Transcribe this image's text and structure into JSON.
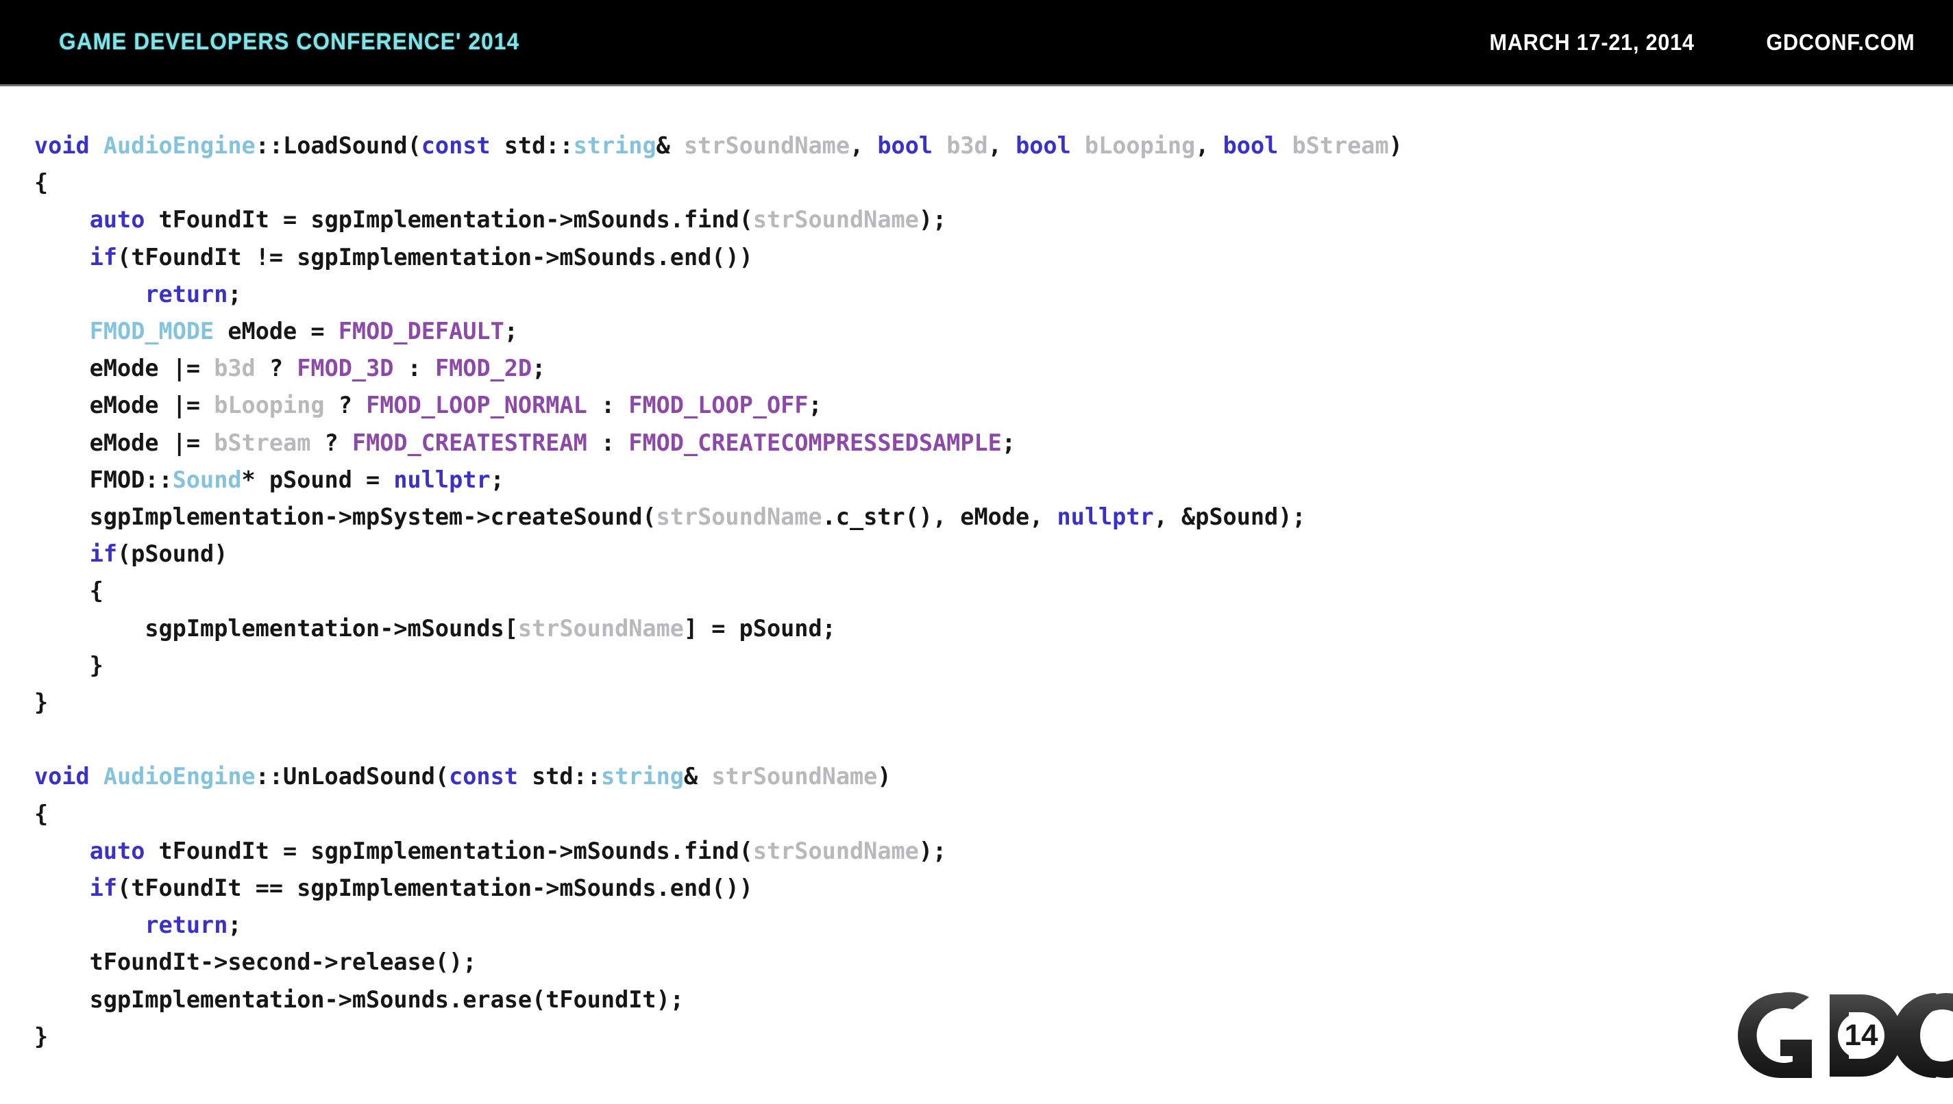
{
  "header": {
    "conference_title": "GAME DEVELOPERS CONFERENCE' 2014",
    "dates": "MARCH 17-21, 2014",
    "url": "GDCONF.COM",
    "bar_background": "#000000",
    "title_color": "#7fe3e8",
    "text_color": "#ffffff"
  },
  "logo": {
    "letters": "GDC",
    "year_badge": "14"
  },
  "syntax_colors": {
    "keyword": "#3a31c8",
    "type": "#83c3dd",
    "parameter": "#b9b9bc",
    "macro": "#8d49a8",
    "plain": "#161616",
    "background": "#ffffff"
  },
  "code": {
    "language": "cpp",
    "lines": [
      "void AudioEngine::LoadSound(const std::string& strSoundName, bool b3d, bool bLooping, bool bStream)",
      "{",
      "    auto tFoundIt = sgpImplementation->mSounds.find(strSoundName);",
      "    if(tFoundIt != sgpImplementation->mSounds.end())",
      "        return;",
      "    FMOD_MODE eMode = FMOD_DEFAULT;",
      "    eMode |= b3d ? FMOD_3D : FMOD_2D;",
      "    eMode |= bLooping ? FMOD_LOOP_NORMAL : FMOD_LOOP_OFF;",
      "    eMode |= bStream ? FMOD_CREATESTREAM : FMOD_CREATECOMPRESSEDSAMPLE;",
      "    FMOD::Sound* pSound = nullptr;",
      "    sgpImplementation->mpSystem->createSound(strSoundName.c_str(), eMode, nullptr, &pSound);",
      "    if(pSound)",
      "    {",
      "        sgpImplementation->mSounds[strSoundName] = pSound;",
      "    }",
      "}",
      "",
      "void AudioEngine::UnLoadSound(const std::string& strSoundName)",
      "{",
      "    auto tFoundIt = sgpImplementation->mSounds.find(strSoundName);",
      "    if(tFoundIt == sgpImplementation->mSounds.end())",
      "        return;",
      "    tFoundIt->second->release();",
      "    sgpImplementation->mSounds.erase(tFoundIt);",
      "}"
    ],
    "tokens": [
      [
        [
          "void ",
          "k-kw"
        ],
        [
          "AudioEngine",
          "k-type"
        ],
        [
          "::",
          "k-pln"
        ],
        [
          "LoadSound",
          "k-pln"
        ],
        [
          "(",
          "k-pln"
        ],
        [
          "const ",
          "k-kw"
        ],
        [
          "std",
          "k-pln"
        ],
        [
          "::",
          "k-pln"
        ],
        [
          "string",
          "k-type"
        ],
        [
          "&",
          "k-pln"
        ],
        [
          " ",
          "k-pln"
        ],
        [
          "strSoundName",
          "k-par"
        ],
        [
          ", ",
          "k-pln"
        ],
        [
          "bool ",
          "k-kw"
        ],
        [
          "b3d",
          "k-par"
        ],
        [
          ", ",
          "k-pln"
        ],
        [
          "bool ",
          "k-kw"
        ],
        [
          "bLooping",
          "k-par"
        ],
        [
          ", ",
          "k-pln"
        ],
        [
          "bool ",
          "k-kw"
        ],
        [
          "bStream",
          "k-par"
        ],
        [
          ")",
          "k-pln"
        ]
      ],
      [
        [
          "{",
          "k-pln"
        ]
      ],
      [
        [
          "    ",
          "k-pln"
        ],
        [
          "auto",
          "k-ctl"
        ],
        [
          " tFoundIt = sgpImplementation->mSounds.find(",
          "k-pln"
        ],
        [
          "strSoundName",
          "k-par"
        ],
        [
          ");",
          "k-pln"
        ]
      ],
      [
        [
          "    ",
          "k-pln"
        ],
        [
          "if",
          "k-ctl"
        ],
        [
          "(tFoundIt != sgpImplementation->mSounds.end())",
          "k-pln"
        ]
      ],
      [
        [
          "        ",
          "k-pln"
        ],
        [
          "return",
          "k-ctl"
        ],
        [
          ";",
          "k-pln"
        ]
      ],
      [
        [
          "    ",
          "k-pln"
        ],
        [
          "FMOD_MODE",
          "k-type"
        ],
        [
          " eMode = ",
          "k-pln"
        ],
        [
          "FMOD_DEFAULT",
          "k-mac"
        ],
        [
          ";",
          "k-pln"
        ]
      ],
      [
        [
          "    eMode |= ",
          "k-pln"
        ],
        [
          "b3d",
          "k-par"
        ],
        [
          " ? ",
          "k-pln"
        ],
        [
          "FMOD_3D",
          "k-mac"
        ],
        [
          " : ",
          "k-pln"
        ],
        [
          "FMOD_2D",
          "k-mac"
        ],
        [
          ";",
          "k-pln"
        ]
      ],
      [
        [
          "    eMode |= ",
          "k-pln"
        ],
        [
          "bLooping",
          "k-par"
        ],
        [
          " ? ",
          "k-pln"
        ],
        [
          "FMOD_LOOP_NORMAL",
          "k-mac"
        ],
        [
          " : ",
          "k-pln"
        ],
        [
          "FMOD_LOOP_OFF",
          "k-mac"
        ],
        [
          ";",
          "k-pln"
        ]
      ],
      [
        [
          "    eMode |= ",
          "k-pln"
        ],
        [
          "bStream",
          "k-par"
        ],
        [
          " ? ",
          "k-pln"
        ],
        [
          "FMOD_CREATESTREAM",
          "k-mac"
        ],
        [
          " : ",
          "k-pln"
        ],
        [
          "FMOD_CREATECOMPRESSEDSAMPLE",
          "k-mac"
        ],
        [
          ";",
          "k-pln"
        ]
      ],
      [
        [
          "    FMOD::",
          "k-pln"
        ],
        [
          "Sound",
          "k-type"
        ],
        [
          "* pSound = ",
          "k-pln"
        ],
        [
          "nullptr",
          "k-ctl"
        ],
        [
          ";",
          "k-pln"
        ]
      ],
      [
        [
          "    sgpImplementation->mpSystem->createSound(",
          "k-pln"
        ],
        [
          "strSoundName",
          "k-par"
        ],
        [
          ".c_str(), eMode, ",
          "k-pln"
        ],
        [
          "nullptr",
          "k-ctl"
        ],
        [
          ", &pSound);",
          "k-pln"
        ]
      ],
      [
        [
          "    ",
          "k-pln"
        ],
        [
          "if",
          "k-ctl"
        ],
        [
          "(pSound)",
          "k-pln"
        ]
      ],
      [
        [
          "    {",
          "k-pln"
        ]
      ],
      [
        [
          "        sgpImplementation->mSounds[",
          "k-pln"
        ],
        [
          "strSoundName",
          "k-par"
        ],
        [
          "] = pSound;",
          "k-pln"
        ]
      ],
      [
        [
          "    }",
          "k-pln"
        ]
      ],
      [
        [
          "}",
          "k-pln"
        ]
      ],
      [
        [
          "",
          "k-pln"
        ]
      ],
      [
        [
          "void ",
          "k-kw"
        ],
        [
          "AudioEngine",
          "k-type"
        ],
        [
          "::",
          "k-pln"
        ],
        [
          "UnLoadSound",
          "k-pln"
        ],
        [
          "(",
          "k-pln"
        ],
        [
          "const ",
          "k-kw"
        ],
        [
          "std",
          "k-pln"
        ],
        [
          "::",
          "k-pln"
        ],
        [
          "string",
          "k-type"
        ],
        [
          "&",
          "k-pln"
        ],
        [
          " ",
          "k-pln"
        ],
        [
          "strSoundName",
          "k-par"
        ],
        [
          ")",
          "k-pln"
        ]
      ],
      [
        [
          "{",
          "k-pln"
        ]
      ],
      [
        [
          "    ",
          "k-pln"
        ],
        [
          "auto",
          "k-ctl"
        ],
        [
          " tFoundIt = sgpImplementation->mSounds.find(",
          "k-pln"
        ],
        [
          "strSoundName",
          "k-par"
        ],
        [
          ");",
          "k-pln"
        ]
      ],
      [
        [
          "    ",
          "k-pln"
        ],
        [
          "if",
          "k-ctl"
        ],
        [
          "(tFoundIt == sgpImplementation->mSounds.end())",
          "k-pln"
        ]
      ],
      [
        [
          "        ",
          "k-pln"
        ],
        [
          "return",
          "k-ctl"
        ],
        [
          ";",
          "k-pln"
        ]
      ],
      [
        [
          "    tFoundIt->second->release();",
          "k-pln"
        ]
      ],
      [
        [
          "    sgpImplementation->mSounds.erase(tFoundIt);",
          "k-pln"
        ]
      ],
      [
        [
          "}",
          "k-pln"
        ]
      ]
    ]
  }
}
